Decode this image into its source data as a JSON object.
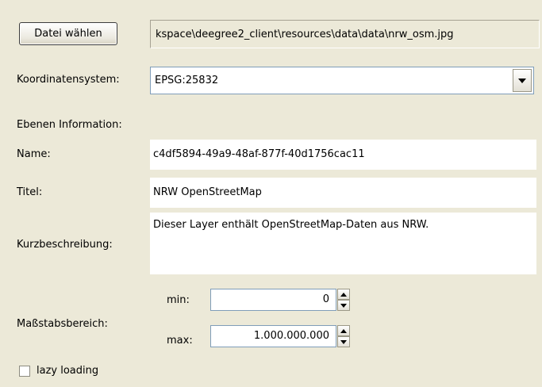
{
  "file": {
    "button_label": "Datei wählen",
    "path": "kspace\\deegree2_client\\resources\\data\\data\\nrw_osm.jpg"
  },
  "crs": {
    "label": "Koordinatensystem:",
    "value": "EPSG:25832"
  },
  "layer_info": {
    "heading": "Ebenen Information:",
    "name_label": "Name:",
    "name_value": "c4df5894-49a9-48af-877f-40d1756cac11",
    "title_label": "Titel:",
    "title_value": "NRW OpenStreetMap",
    "description_label": "Kurzbeschreibung:",
    "description_value": "Dieser Layer enthält OpenStreetMap-Daten aus NRW."
  },
  "scale": {
    "label": "Maßstabsbereich:",
    "min_label": "min:",
    "min_value": "0",
    "max_label": "max:",
    "max_value": "1.000.000.000"
  },
  "lazy_loading": {
    "label": "lazy loading",
    "checked": false
  }
}
